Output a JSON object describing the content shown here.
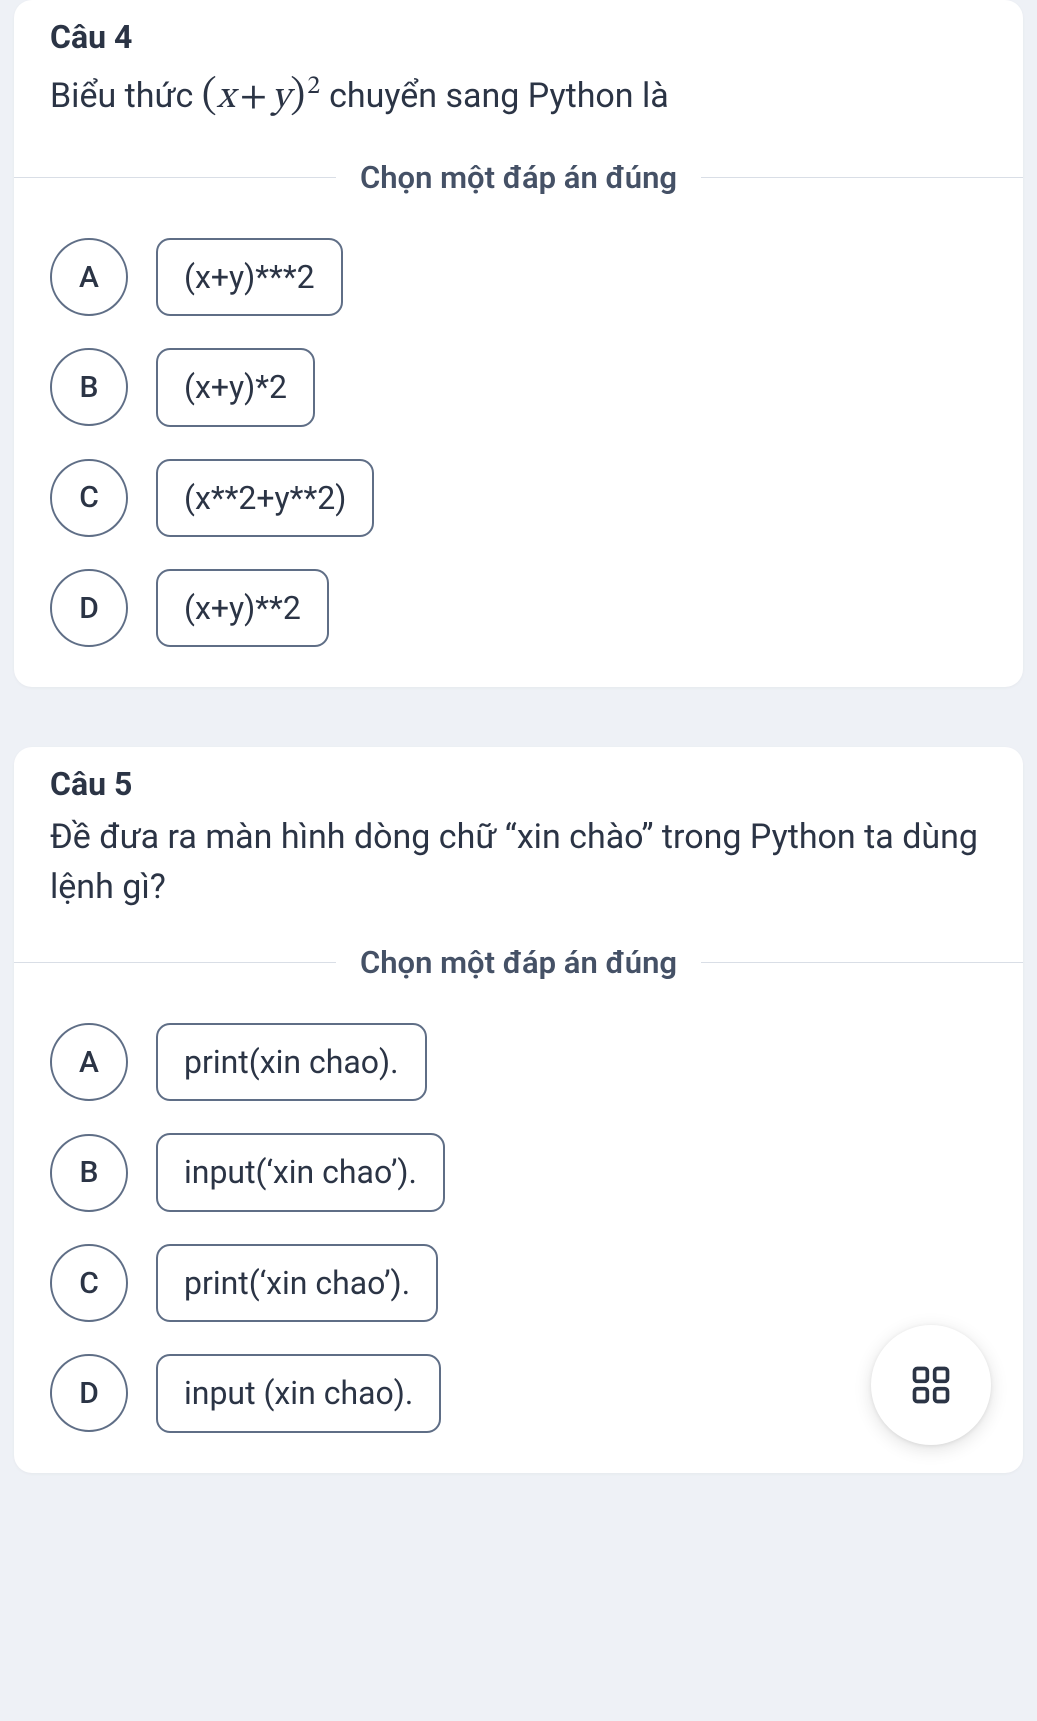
{
  "instruction_label": "Chọn một đáp án đúng",
  "questions": [
    {
      "title": "Câu 4",
      "text_prefix": "Biểu thức ",
      "expression": "(x + y)²",
      "expression_parts": {
        "open": "(",
        "x": "x",
        "plus": "+",
        "y": "y",
        "close": ")",
        "sup": "2"
      },
      "text_suffix": " chuyển sang Python là",
      "choices": [
        {
          "letter": "A",
          "text": "(x+y)***2"
        },
        {
          "letter": "B",
          "text": "(x+y)*2"
        },
        {
          "letter": "C",
          "text": "(x**2+y**2)"
        },
        {
          "letter": "D",
          "text": "(x+y)**2"
        }
      ]
    },
    {
      "title": "Câu 5",
      "text_full": "Đề đưa ra màn hình dòng chữ “xin chào” trong Python ta dùng lệnh gì?",
      "choices": [
        {
          "letter": "A",
          "text": "print(xin chao)."
        },
        {
          "letter": "B",
          "text": "input(‘xin chao’)."
        },
        {
          "letter": "C",
          "text": "print(‘xin chao’)."
        },
        {
          "letter": "D",
          "text": "input (xin chao)."
        }
      ]
    }
  ],
  "fab_icon_name": "grid-menu-icon"
}
